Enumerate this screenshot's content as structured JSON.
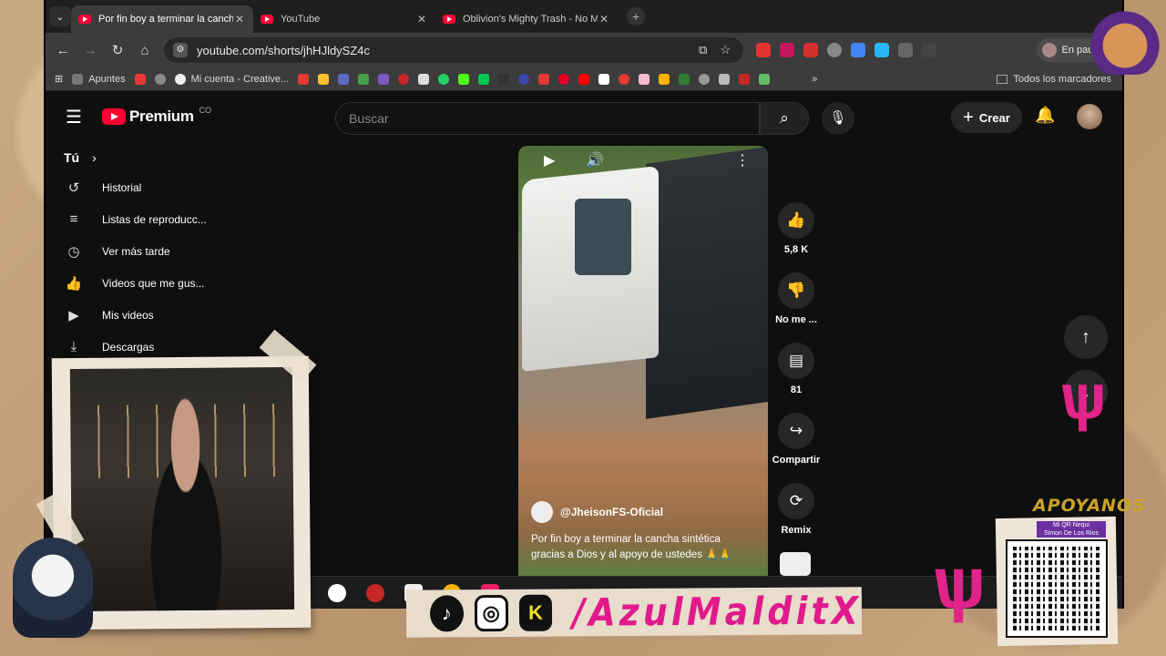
{
  "browser": {
    "tabs": [
      {
        "title": "Por fin boy a terminar la cancha",
        "active": true
      },
      {
        "title": "YouTube",
        "active": false
      },
      {
        "title": "Oblivion's Mighty Trash - No M",
        "active": false
      }
    ],
    "url": "youtube.com/shorts/jhHJldySZ4c",
    "profile_label": "En pausa",
    "bookmarks": [
      "Apuntes",
      "Mi cuenta - Creative..."
    ],
    "bookmarks_all": "Todos los marcadores"
  },
  "youtube": {
    "logo_text": "Premium",
    "logo_sup": "CO",
    "search_placeholder": "Buscar",
    "create_label": "Crear",
    "sidebar": {
      "you_label": "Tú",
      "items": [
        {
          "label": "Historial",
          "icon": "history-icon"
        },
        {
          "label": "Listas de reproducc...",
          "icon": "playlist-icon"
        },
        {
          "label": "Ver más tarde",
          "icon": "clock-icon"
        },
        {
          "label": "Videos que me gus...",
          "icon": "thumbs-up-icon"
        },
        {
          "label": "Mis videos",
          "icon": "video-icon"
        },
        {
          "label": "Descargas",
          "icon": "download-icon"
        }
      ]
    },
    "short": {
      "channel": "@JheisonFS-Oficial",
      "description": "Por fin boy a terminar la cancha sintética gracias a Dios y al apoyo de ustedes 🙏🙏"
    },
    "actions": {
      "likes": "5,8 K",
      "dislike": "No me ...",
      "comments": "81",
      "share": "Compartir",
      "remix": "Remix"
    }
  },
  "overlay": {
    "handle": "/AzulMalditX",
    "qr_title": "APOYANOS",
    "qr_line1": "Mi QR Nequi",
    "qr_line2": "Simon De Los Rios",
    "accent": "#e0248a"
  }
}
